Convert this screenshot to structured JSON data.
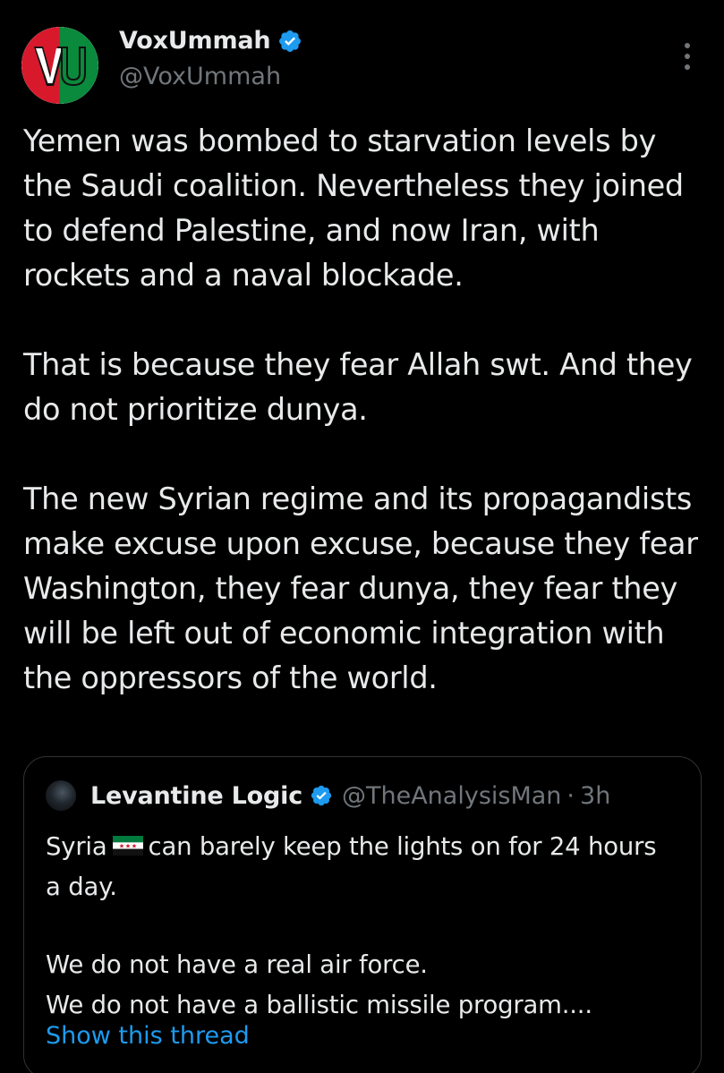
{
  "author": {
    "display_name": "VoxUmmah",
    "handle": "@VoxUmmah",
    "avatar_letters": "VU",
    "verified": true
  },
  "tweet": {
    "paragraphs": [
      "Yemen was bombed to starvation levels by the Saudi coalition. Nevertheless they joined to defend Palestine, and now Iran, with rockets and a naval blockade.",
      "That is because they fear Allah swt. And they do not prioritize dunya.",
      "The new Syrian regime and its propagandists make excuse upon excuse, because they fear Washington, they fear dunya, they fear they will be left out of economic integration with the oppressors of the world."
    ]
  },
  "quote": {
    "display_name": "Levantine Logic",
    "handle": "@TheAnalysisMan",
    "separator": "·",
    "time": "3h",
    "verified": true,
    "line1_before_flag": "Syria",
    "line1_after_flag": "can barely keep the lights on for 24 hours a day.",
    "line2": "We do not have a real air force.",
    "line3": "We do not have a ballistic missile program....",
    "show_thread": "Show this thread"
  },
  "colors": {
    "background": "#000000",
    "text_primary": "#e7e9ea",
    "text_secondary": "#71767b",
    "accent_link": "#1d9bf0",
    "verified_badge": "#1d9bf0",
    "border": "#2f3336"
  }
}
